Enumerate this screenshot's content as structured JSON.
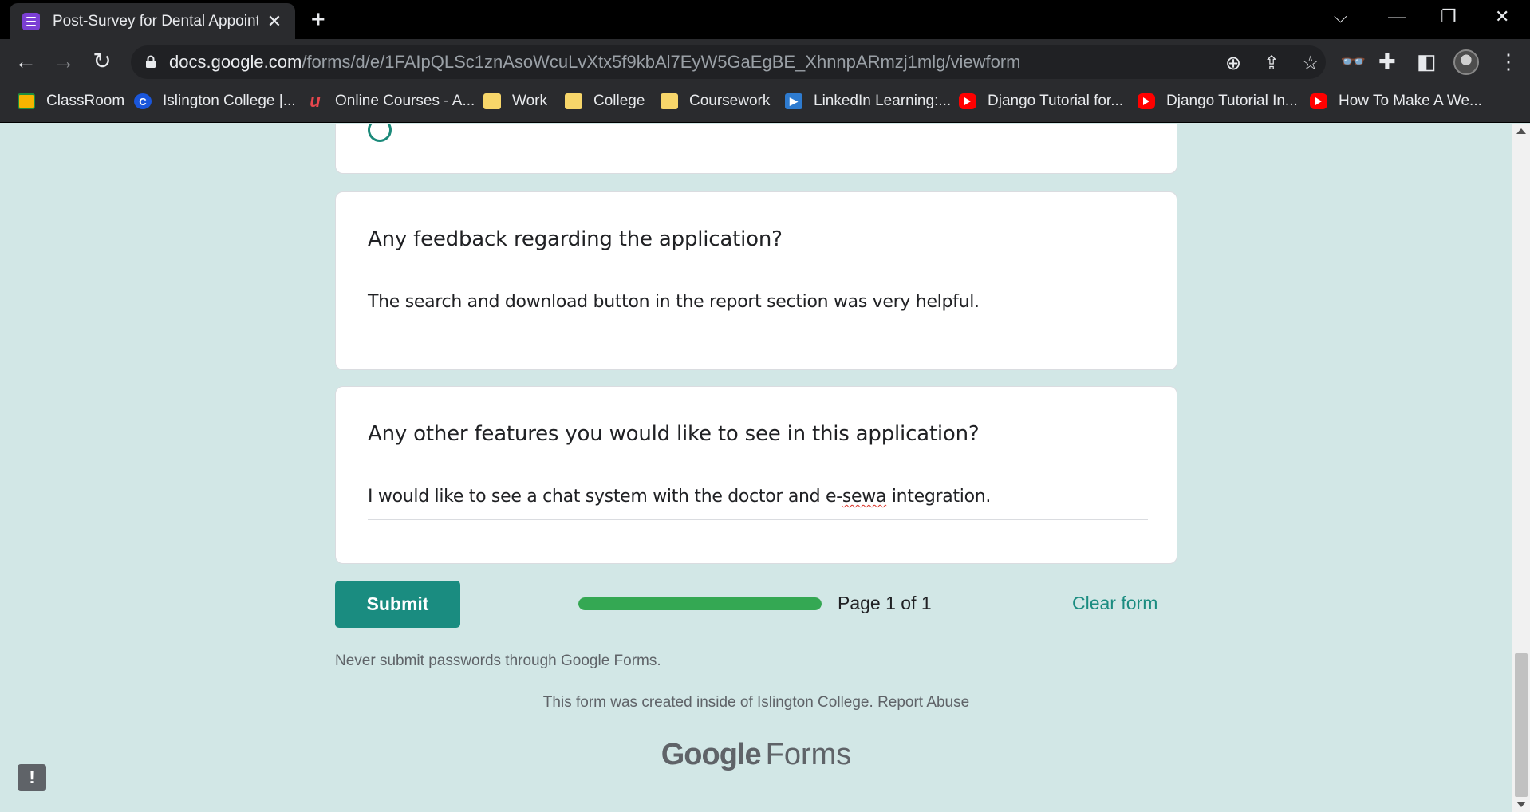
{
  "browser": {
    "tab_title": "Post-Survey for Dental Appointm",
    "new_tab_symbol": "+",
    "url_host": "docs.google.com",
    "url_path": "/forms/d/e/1FAIpQLSc1znAsoWcuLvXtx5f9kbAl7EyW5GaEgBE_XhnnpARmzj1mlg/viewform",
    "bookmarks": [
      {
        "label": "ClassRoom",
        "icon": "classroom-icon"
      },
      {
        "label": "Islington College |...",
        "icon": "islington-icon"
      },
      {
        "label": "Online Courses - A...",
        "icon": "udemy-icon"
      },
      {
        "label": "Work",
        "icon": "folder-icon"
      },
      {
        "label": "College",
        "icon": "folder-icon"
      },
      {
        "label": "Coursework",
        "icon": "folder-icon"
      },
      {
        "label": "LinkedIn Learning:...",
        "icon": "linkedin-learning-icon"
      },
      {
        "label": "Django Tutorial for...",
        "icon": "youtube-icon"
      },
      {
        "label": "Django Tutorial In...",
        "icon": "youtube-icon"
      },
      {
        "label": "How To Make A We...",
        "icon": "youtube-icon"
      }
    ]
  },
  "form": {
    "questions": [
      {
        "title": "Any feedback regarding the application?",
        "answer": "The search and download button in the report section was very helpful."
      },
      {
        "title": "Any other features you would like to see in this application?",
        "answer_before": "I would like to see a chat system with the doctor and e-",
        "answer_misspelled": "sewa",
        "answer_after": " integration."
      }
    ],
    "submit_label": "Submit",
    "progress": 1.0,
    "page_label": "Page 1 of 1",
    "clear_label": "Clear form",
    "password_note": "Never submit passwords through Google Forms.",
    "created_text": "This form was created inside of Islington College.",
    "report_abuse": "Report Abuse",
    "brand_google": "Google",
    "brand_forms": "Forms",
    "feedback_symbol": "!"
  },
  "colors": {
    "page_bg": "#d2e7e6",
    "accent": "#1a8c80",
    "progress": "#34a853"
  }
}
